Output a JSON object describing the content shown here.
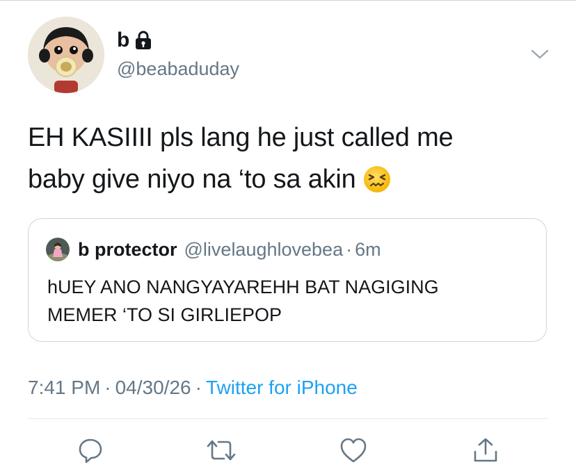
{
  "author": {
    "display_name": "b",
    "handle": "@beabaduday",
    "protected": true
  },
  "tweet": {
    "lines": [
      "EH KASIIII pls lang he just called me",
      "baby give niyo na ‘to sa akin"
    ],
    "emoji": "confounded-face"
  },
  "quote": {
    "display_name": "b protector",
    "handle": "@livelaughlovebea",
    "separator": "·",
    "time": "6m",
    "lines": [
      "hUEY ANO NANGYAYAREHH BAT NAGIGING",
      "MEMER ‘TO SI GIRLIEPOP"
    ]
  },
  "meta": {
    "time": "7:41 PM",
    "separator": "·",
    "date": "04/30/26",
    "source": "Twitter for iPhone"
  },
  "actions": [
    {
      "name": "reply",
      "icon": "speech-bubble-icon"
    },
    {
      "name": "retweet",
      "icon": "retweet-icon"
    },
    {
      "name": "like",
      "icon": "heart-icon"
    },
    {
      "name": "share",
      "icon": "share-icon"
    }
  ],
  "colors": {
    "text": "#14171a",
    "secondary": "#657786",
    "link": "#1da1f2",
    "border": "#ccd6dd"
  }
}
